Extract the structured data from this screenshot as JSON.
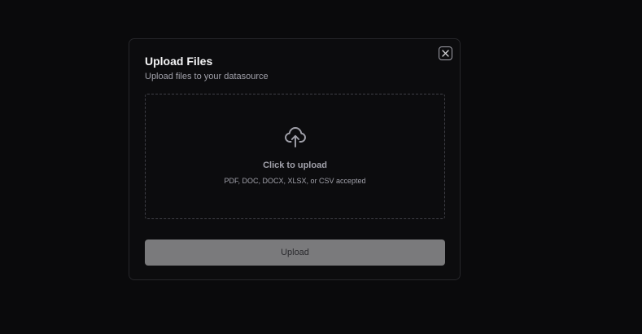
{
  "modal": {
    "title": "Upload Files",
    "subtitle": "Upload files to your datasource",
    "close_icon": "x-icon",
    "dropzone": {
      "icon": "cloud-upload-icon",
      "title": "Click to upload",
      "hint": "PDF, DOC, DOCX, XLSX, or CSV accepted"
    },
    "upload_button_label": "Upload",
    "upload_button_state": "disabled"
  },
  "colors": {
    "background": "#0a0a0c",
    "modal_background": "#0c0c0e",
    "modal_border": "#26262a",
    "text_primary": "#f4f4f5",
    "text_muted": "#a1a1aa",
    "button_disabled": "#7a7a7c"
  }
}
